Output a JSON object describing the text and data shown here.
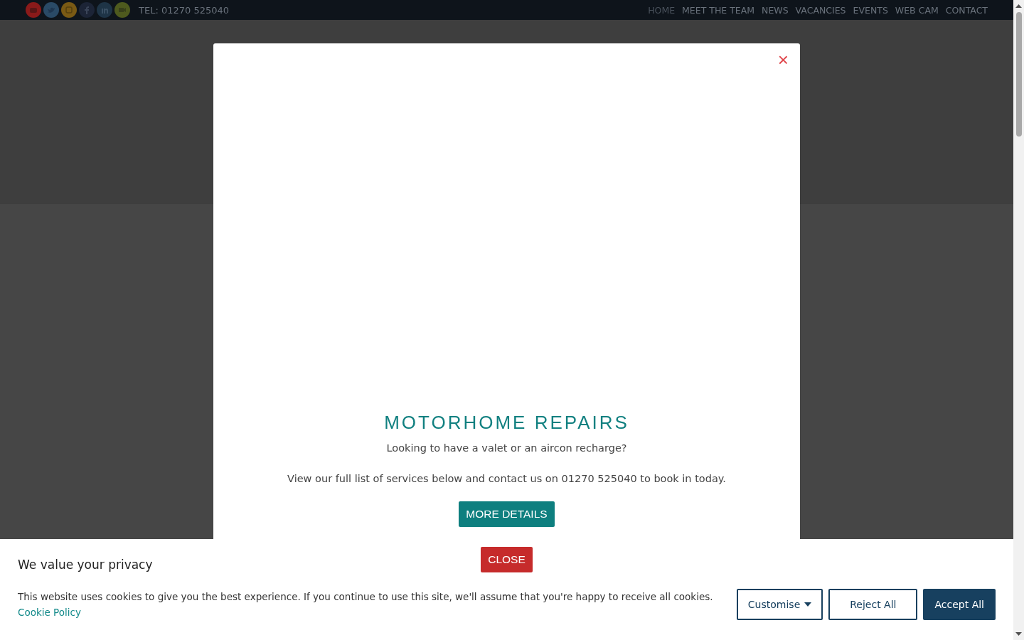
{
  "top_bar": {
    "social_icons": [
      {
        "kind": "youtube",
        "color": "#8a1a1a"
      },
      {
        "kind": "twitter",
        "color": "#2a4a66"
      },
      {
        "kind": "instagram",
        "color": "#7a5a14"
      },
      {
        "kind": "facebook",
        "color": "#1c2436"
      },
      {
        "kind": "linkedin",
        "color": "#1e3446"
      },
      {
        "kind": "camera",
        "color": "#4e5a1e"
      }
    ],
    "phone": "TEL: 01270 525040",
    "nav": [
      {
        "label": "HOME",
        "selected": true
      },
      {
        "label": "MEET THE TEAM",
        "selected": false
      },
      {
        "label": "NEWS",
        "selected": false
      },
      {
        "label": "VACANCIES",
        "selected": false
      },
      {
        "label": "EVENTS",
        "selected": false
      },
      {
        "label": "WEB CAM",
        "selected": false
      },
      {
        "label": "CONTACT",
        "selected": false
      }
    ]
  },
  "modal": {
    "close_icon": "×",
    "title": "MOTORHOME REPAIRS",
    "paragraphs": [
      "Looking to have a valet or an aircon recharge?",
      "View our full list of services below and contact us on 01270 525040 to book in today."
    ],
    "buttons": [
      {
        "label": "MORE DETAILS",
        "kind": "primary"
      },
      {
        "label": "CLOSE",
        "kind": "danger"
      }
    ]
  },
  "cookie_banner": {
    "title": "We value your privacy",
    "text": "This website uses cookies to give you the best experience. If you continue to use this site, we'll assume that you're happy to receive all cookies.",
    "link": "Cookie Policy",
    "buttons": [
      {
        "label": "Customise",
        "kind": "dropdown"
      },
      {
        "label": "Reject All",
        "kind": "outline"
      },
      {
        "label": "Accept All",
        "kind": "solid"
      }
    ]
  }
}
